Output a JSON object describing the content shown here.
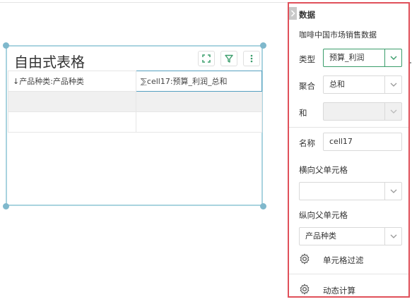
{
  "widget": {
    "title": "自由式表格",
    "icons": [
      "fullscreen-icon",
      "filter-icon",
      "more-vertical-icon"
    ],
    "table": {
      "rows": [
        [
          "↓产品种类:产品种类",
          "⅀cell17:预算_利润_总和"
        ],
        [
          "",
          ""
        ],
        [
          "",
          ""
        ]
      ]
    }
  },
  "panel": {
    "section_title": "数据",
    "dataset": "咖啡中国市场销售数据",
    "type_label": "类型",
    "type_value": "预算_利润",
    "agg_label": "聚合",
    "agg_value": "总和",
    "and_label": "和",
    "and_value": "",
    "name_label": "名称",
    "name_value": "cell17",
    "h_parent_label": "横向父单元格",
    "h_parent_value": "",
    "v_parent_label": "纵向父单元格",
    "v_parent_value": "产品种类",
    "cell_filter": "单元格过滤",
    "dynamic_calc": "动态计算"
  },
  "colors": {
    "accent_green": "#3a9d6b",
    "panel_border": "#e0505a",
    "selection_blue": "#55a0c0"
  }
}
